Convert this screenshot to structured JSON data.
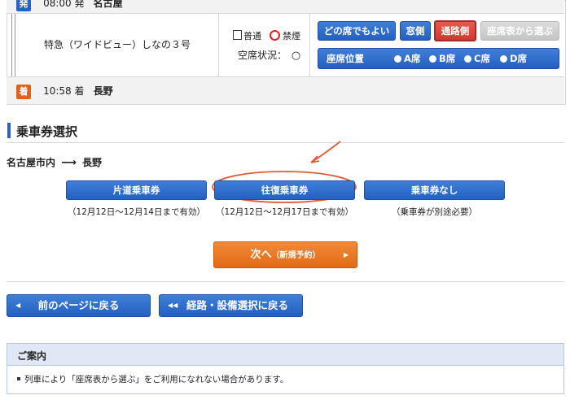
{
  "departure": {
    "badge": "発",
    "time": "08:00 発",
    "station": "名古屋"
  },
  "train": {
    "name": "特急（ワイドビュー）しなの３号",
    "car_type": "普通",
    "smoking": "禁煙",
    "vacancy_label": "空席状況：",
    "vacancy_mark": "○"
  },
  "seat_buttons": {
    "any": "どの席でもよい",
    "window": "窓側",
    "aisle": "通路側",
    "chart": "座席表から選ぶ"
  },
  "seat_position": {
    "label": "座席位置",
    "options": [
      "A席",
      "B席",
      "C席",
      "D席"
    ]
  },
  "arrival": {
    "badge": "着",
    "time": "10:58 着",
    "station": "長野"
  },
  "ticket_section": {
    "title": "乗車券選択",
    "route_from": "名古屋市内",
    "route_to": "長野",
    "options": [
      {
        "label": "片道乗車券",
        "note": "（12月12日〜12月14日まで有効）"
      },
      {
        "label": "往復乗車券",
        "note": "（12月12日〜12月17日まで有効）"
      },
      {
        "label": "乗車券なし",
        "note": "（乗車券が別途必要）"
      }
    ]
  },
  "next_button": {
    "label": "次へ",
    "sub": "（新規予約）"
  },
  "nav": {
    "back_page": "前のページに戻る",
    "back_route": "経路・設備選択に戻る"
  },
  "notice": {
    "title": "ご案内",
    "items": [
      "列車により「座席表から選ぶ」をご利用になれない場合があります。"
    ]
  },
  "colors": {
    "accent_blue": "#2a62c4",
    "accent_orange": "#e26a16",
    "highlight_red": "#d9412f"
  }
}
